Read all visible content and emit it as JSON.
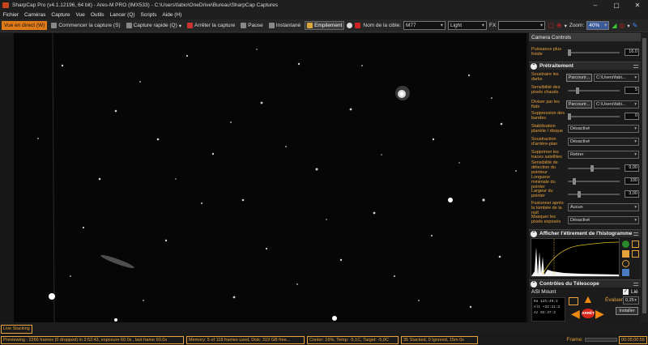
{
  "title": "SharpCap Pro (v4.1.12196, 64 bit) - Ares-M PRO (IMX533) - C:\\Users\\fabio\\OneDrive\\Bureau\\SharpCap Captures",
  "menu": [
    "Fichier",
    "Caméras",
    "Capture",
    "Vue",
    "Outils",
    "Lancer (Q)",
    "Scripts",
    "Aide (H)"
  ],
  "toolbar": {
    "live": "Vue en direct (W)",
    "start_capture": "Commencer la capture (S)",
    "quick_capture": "Capture rapide (Q)",
    "stop_capture": "Arrêter la capture",
    "pause": "Pause",
    "snapshot": "Instantané",
    "stacking": "Empilement",
    "target_label": "Nom de la cible:",
    "target_value": "M77",
    "filter_value": "Light",
    "fx_label": "FX",
    "zoom_label": "Zoom:",
    "zoom_value": "40%"
  },
  "panel": {
    "camera_controls": "Camera Controls",
    "puissance_label": "Puissance plus froide",
    "puissance_value": "16.0",
    "pretraitement": "Prétraitement",
    "rows": {
      "darks": "Soustraire les darks",
      "browse1": "Parcourir...",
      "path1": "C:\\Users\\fabi...",
      "hot_label": "Sensibilité des pixels chauds",
      "hot_value": "5",
      "flats": "Diviser par les flats",
      "browse2": "Parcourir...",
      "path2": "C:\\Users\\fabi...",
      "bands": "Suppression des bandes",
      "bands_value": "0",
      "stab_label": "Stabilisation planète / disque",
      "stab_value": "Désactivé",
      "bg_label": "Soustraction d'arrière-plan",
      "bg_value": "Désactivé",
      "sat_label": "Supprimer les traces satellites",
      "sat_value": "Retirer",
      "sens_label": "Sensibilité de détection du pointeur",
      "sens_value": "9,00",
      "len_label": "Longueur minimale du pointer",
      "len_value": "100",
      "width_label": "Largeur du pointer",
      "width_value": "3,00",
      "undo_label": "Fusionner après la tombée de la nuit",
      "undo_value": "Aucun",
      "mask_label": "Masquer les pixels exposés",
      "mask_value": "Désactivé"
    },
    "histogram": "Afficher l'étirement de l'histogramme",
    "telescope": "Contrôles du Télescope",
    "mount": "ASI Mount",
    "lie": "Lié",
    "evaluate_label": "Évaluer:",
    "evaluate_value": "0,25",
    "ra": "Ra  12h:49:2",
    "alt": "Alt  +32:11:2",
    "az": "Az  02:47:2",
    "install": "Installer",
    "stop": "ARRÊT"
  },
  "live_stacking": "Live Stacking",
  "status": {
    "preview": "Previewing : 2266 frames (0 dropped) in 3:52:43, exposure 60.0s , last frame 60.0s",
    "memory": "Memory: 5 of 118 frames used, Disk: 319 GB free...",
    "cooler": "Cooler: 16%, Temp: -5,1C, Target: -5,0C",
    "stacked": "35 Stacked, 0 Ignored, 15m 0s",
    "frame_label": "Frame:",
    "time": "00:05;00:55"
  },
  "colors": {
    "accent": "#e8a33c",
    "orange_btn": "#e07a16",
    "highlight": "#e0c020"
  }
}
